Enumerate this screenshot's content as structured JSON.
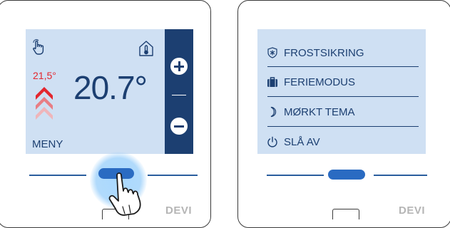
{
  "left_panel": {
    "setpoint": "21,5°",
    "temperature": "20.7°",
    "menu_label": "MENY",
    "logo": "DEVI"
  },
  "right_panel": {
    "menu_items": [
      {
        "label": "FROSTSIKRING",
        "icon": "snowflake-shield-icon"
      },
      {
        "label": "FERIEMODUS",
        "icon": "suitcase-icon"
      },
      {
        "label": "MØRKT TEMA",
        "icon": "moon-icon"
      },
      {
        "label": "SLÅ AV",
        "icon": "power-icon"
      }
    ],
    "logo": "DEVI"
  },
  "colors": {
    "screen_bg": "#cfe0f3",
    "primary": "#1c3f71",
    "setpoint_red": "#e3262e",
    "button_blue": "#2a6bc2"
  }
}
